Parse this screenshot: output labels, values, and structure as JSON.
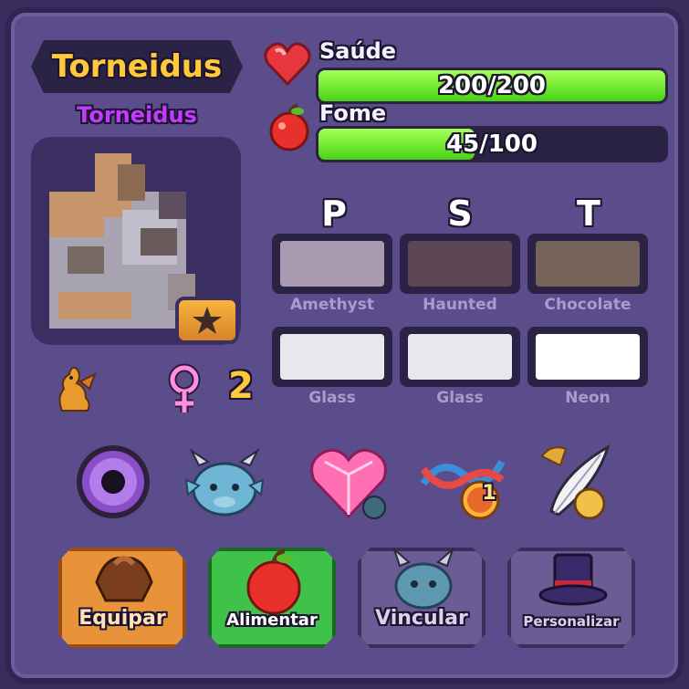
{
  "pet": {
    "name": "Torneidus",
    "subname": "Torneidus",
    "age": "2"
  },
  "stats": {
    "health": {
      "label": "Saúde",
      "text": "200/200",
      "fraction": 1.0
    },
    "hunger": {
      "label": "Fome",
      "text": "45/100",
      "fraction": 0.45
    }
  },
  "colors": {
    "headers": [
      "P",
      "S",
      "T"
    ],
    "row1": [
      {
        "label": "Amethyst",
        "hex": "#a99ab0"
      },
      {
        "label": "Haunted",
        "hex": "#5c4654"
      },
      {
        "label": "Chocolate",
        "hex": "#76635a"
      }
    ],
    "row2": [
      {
        "label": "Glass",
        "hex": "#e8e8ec"
      },
      {
        "label": "Glass",
        "hex": "#e8e8ec"
      },
      {
        "label": "Neon",
        "hex": "#ffffff"
      }
    ]
  },
  "icons": [
    "eye-icon",
    "dragon-head-icon",
    "heart-gem-icon",
    "dna-medal-icon",
    "feather-hat-icon"
  ],
  "dna_badge": "1",
  "actions": {
    "equip": "Equipar",
    "feed": "Alimentar",
    "bond": "Vincular",
    "customize": "Personalizar"
  },
  "accent_colors": {
    "gold": "#ffc93c",
    "purple_name": "#c23bff",
    "bar_green": "#47d313"
  }
}
